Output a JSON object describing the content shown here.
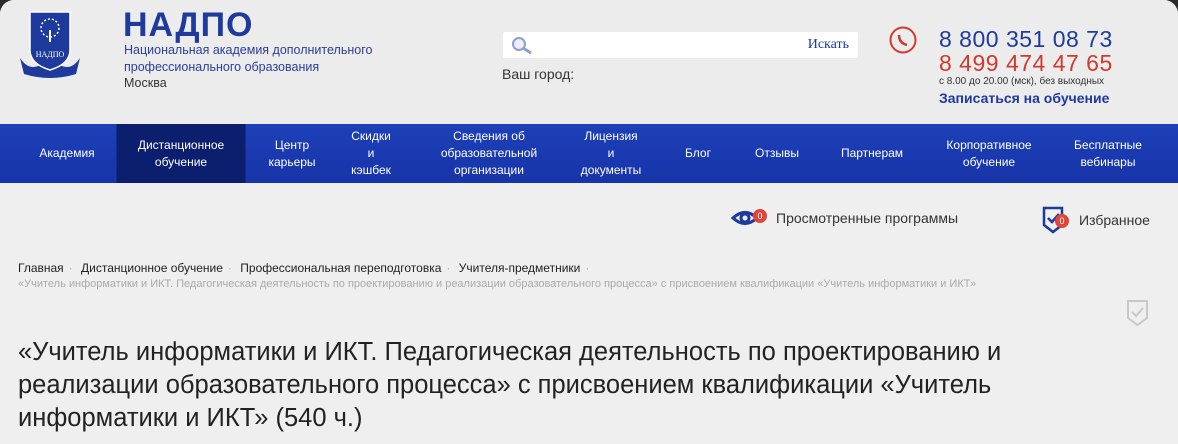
{
  "header": {
    "brand": "НАДПО",
    "subtitle_line1": "Национальная академия дополнительного",
    "subtitle_line2": "профессионального образования",
    "city": "Москва",
    "logo_text": "НАДПО",
    "search": {
      "placeholder": "",
      "button": "Искать"
    },
    "city_label": "Ваш город:",
    "phone1": "8 800 351 08 73",
    "phone2": "8 499 474 47 65",
    "hours": "с 8.00 до 20.00 (мск), без выходных",
    "enroll": "Записаться на обучение"
  },
  "nav": [
    "Академия",
    "Дистанционное\nобучение",
    "Центр\nкарьеры",
    "Скидки\nи\nкэшбек",
    "Сведения об\nобразовательной\nорганизации",
    "Лицензия\nи\nдокументы",
    "Блог",
    "Отзывы",
    "Партнерам",
    "Корпоративное\nобучение",
    "Бесплатные\nвебинары"
  ],
  "tools": {
    "viewed": "Просмотренные программы",
    "viewed_count": "0",
    "favorites": "Избранное",
    "favorites_count": "0"
  },
  "breadcrumb": [
    "Главная",
    "Дистанционное обучение",
    "Профессиональная переподготовка",
    "Учителя-предметники"
  ],
  "breadcrumb_current": "«Учитель информатики и ИКТ. Педагогическая деятельность по проектированию и реализации образовательного процесса» с присвоением квалификации «Учитель информатики и ИКТ»",
  "title": "«Учитель информатики и ИКТ. Педагогическая деятельность по проектированию и реализации образовательного процесса» с присвоением квалификации «Учитель информатики и ИКТ» (540 ч.)"
}
